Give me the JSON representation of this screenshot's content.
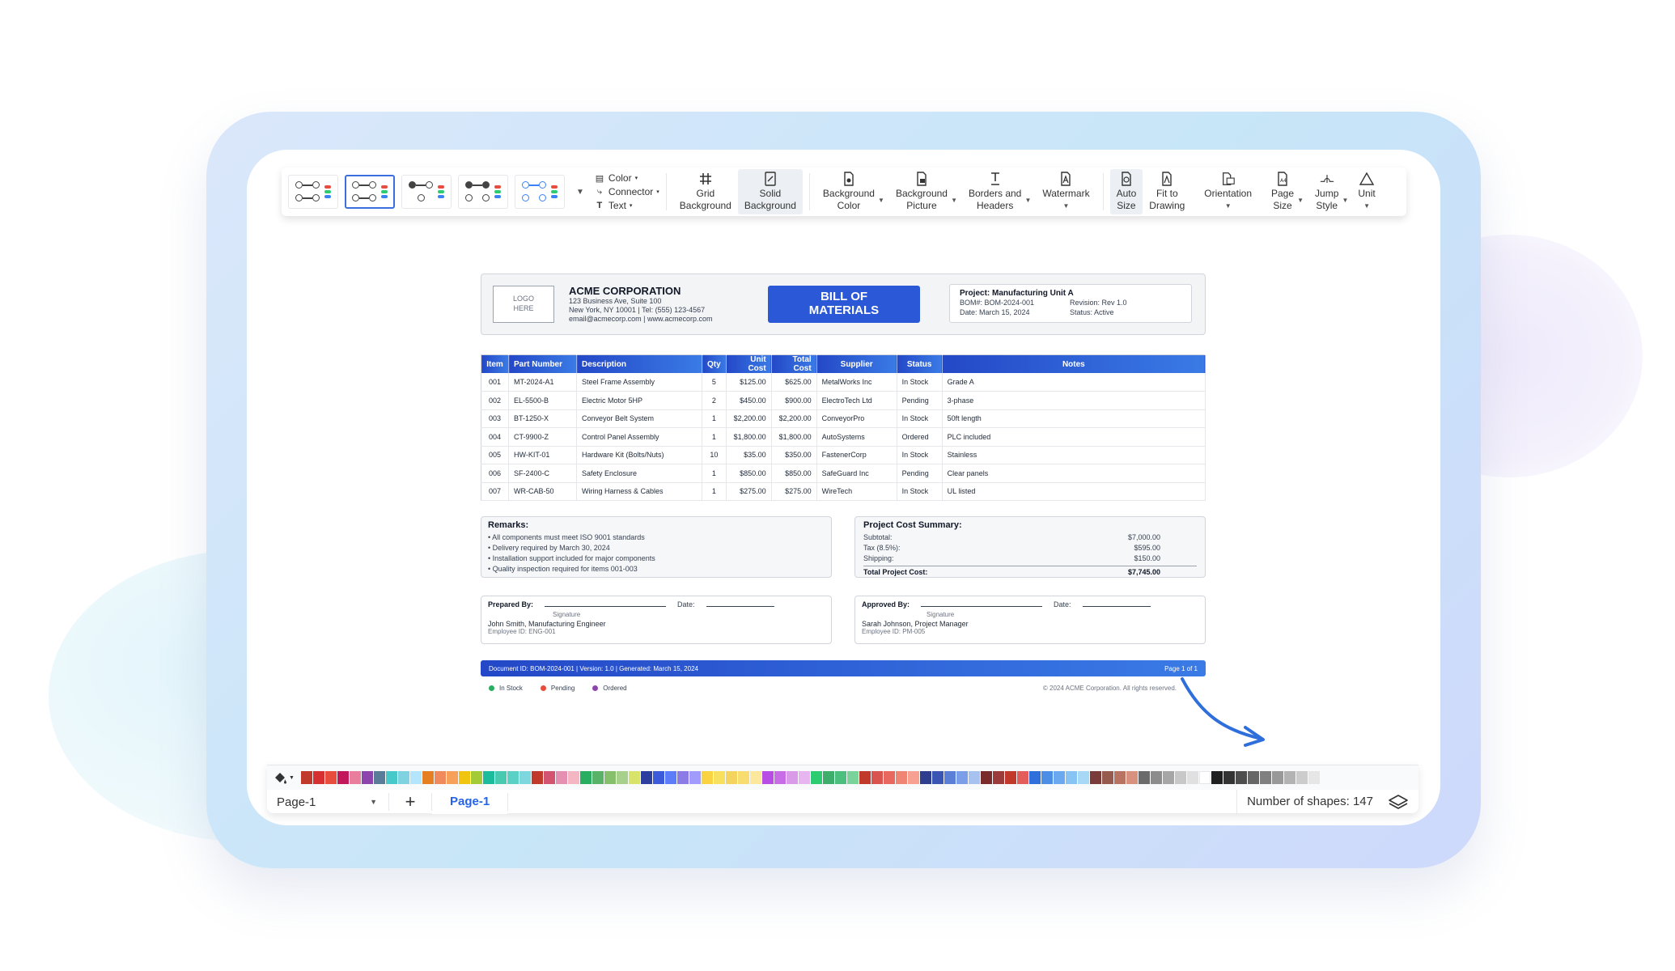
{
  "toolbar": {
    "style_items": [
      {
        "icon": "color-icon",
        "label": "Color"
      },
      {
        "icon": "connector-icon",
        "label": "Connector"
      },
      {
        "icon": "text-icon",
        "label": "Text"
      }
    ],
    "buttons": [
      {
        "name": "grid-background",
        "line1": "Grid",
        "line2": "Background"
      },
      {
        "name": "solid-background",
        "line1": "Solid",
        "line2": "Background"
      },
      {
        "name": "background-color",
        "line1": "Background",
        "line2": "Color"
      },
      {
        "name": "background-picture",
        "line1": "Background",
        "line2": "Picture"
      },
      {
        "name": "borders-and-headers",
        "line1": "Borders and",
        "line2": "Headers"
      },
      {
        "name": "watermark",
        "line1": "Watermark",
        "line2": ""
      },
      {
        "name": "auto-size",
        "line1": "Auto",
        "line2": "Size"
      },
      {
        "name": "fit-to-drawing",
        "line1": "Fit to",
        "line2": "Drawing"
      },
      {
        "name": "orientation",
        "line1": "Orientation",
        "line2": ""
      },
      {
        "name": "page-size",
        "line1": "Page",
        "line2": "Size"
      },
      {
        "name": "jump-style",
        "line1": "Jump",
        "line2": "Style"
      },
      {
        "name": "unit",
        "line1": "Unit",
        "line2": ""
      }
    ]
  },
  "doc": {
    "logo": "LOGO\nHERE",
    "company_name": "ACME CORPORATION",
    "company_address": "123 Business Ave, Suite 100",
    "company_city": "New York, NY 10001 | Tel: (555) 123-4567",
    "company_email": "email@acmecorp.com | www.acmecorp.com",
    "title_line1": "BILL OF",
    "title_line2": "MATERIALS",
    "project": "Project: Manufacturing Unit A",
    "bom_no": "BOM#: BOM-2024-001",
    "revision": "Revision: Rev 1.0",
    "date": "Date: March 15, 2024",
    "status": "Status: Active",
    "columns": [
      "Item",
      "Part Number",
      "Description",
      "Qty",
      "Unit Cost",
      "Total Cost",
      "Supplier",
      "Status",
      "Notes"
    ],
    "rows": [
      [
        "001",
        "MT-2024-A1",
        "Steel Frame Assembly",
        "5",
        "$125.00",
        "$625.00",
        "MetalWorks Inc",
        "In Stock",
        "Grade A"
      ],
      [
        "002",
        "EL-5500-B",
        "Electric Motor 5HP",
        "2",
        "$450.00",
        "$900.00",
        "ElectroTech Ltd",
        "Pending",
        "3-phase"
      ],
      [
        "003",
        "BT-1250-X",
        "Conveyor Belt System",
        "1",
        "$2,200.00",
        "$2,200.00",
        "ConveyorPro",
        "In Stock",
        "50ft length"
      ],
      [
        "004",
        "CT-9900-Z",
        "Control Panel Assembly",
        "1",
        "$1,800.00",
        "$1,800.00",
        "AutoSystems",
        "Ordered",
        "PLC included"
      ],
      [
        "005",
        "HW-KIT-01",
        "Hardware Kit (Bolts/Nuts)",
        "10",
        "$35.00",
        "$350.00",
        "FastenerCorp",
        "In Stock",
        "Stainless"
      ],
      [
        "006",
        "SF-2400-C",
        "Safety Enclosure",
        "1",
        "$850.00",
        "$850.00",
        "SafeGuard Inc",
        "Pending",
        "Clear panels"
      ],
      [
        "007",
        "WR-CAB-50",
        "Wiring Harness & Cables",
        "1",
        "$275.00",
        "$275.00",
        "WireTech",
        "In Stock",
        "UL listed"
      ]
    ],
    "remarks_title": "Remarks:",
    "remarks": [
      "• All components must meet ISO 9001 standards",
      "• Delivery required by March 30, 2024",
      "• Installation support included for major components",
      "• Quality inspection required for items 001-003"
    ],
    "summary_title": "Project Cost Summary:",
    "summary": [
      {
        "label": "Subtotal:",
        "value": "$7,000.00"
      },
      {
        "label": "Tax (8.5%):",
        "value": "$595.00"
      },
      {
        "label": "Shipping:",
        "value": "$150.00"
      }
    ],
    "total_label": "Total Project Cost:",
    "total_value": "$7,745.00",
    "prepared_label": "Prepared By:",
    "approved_label": "Approved By:",
    "date_label": "Date:",
    "signature_label": "Signature",
    "prepared_name": "John Smith, Manufacturing Engineer",
    "prepared_emp": "Employee ID: ENG-001",
    "approved_name": "Sarah Johnson, Project Manager",
    "approved_emp": "Employee ID: PM-005",
    "footer_left": "Document ID: BOM-2024-001 | Version: 1.0 | Generated: March 15, 2024",
    "footer_right": "Page 1 of 1",
    "legend": [
      {
        "label": "In Stock",
        "color": "#27ae60"
      },
      {
        "label": "Pending",
        "color": "#e74c3c"
      },
      {
        "label": "Ordered",
        "color": "#8e44ad"
      }
    ],
    "copyright": "© 2024 ACME Corporation. All rights reserved."
  },
  "palette": [
    "#c0392b",
    "#d63031",
    "#e74c3c",
    "#c2185b",
    "#e87d9e",
    "#8e44ad",
    "#5b7c99",
    "#48c9c9",
    "#7fd3e0",
    "#b3e5fc",
    "#e67e22",
    "#f08a5d",
    "#f6a05a",
    "#f1c40f",
    "#a3cb38",
    "#1abc9c",
    "#48c9b0",
    "#5ad1c5",
    "#7ed6df",
    "#c0392b",
    "#d35470",
    "#e58fb2",
    "#f4b6c2",
    "#27ae60",
    "#58b368",
    "#86c06c",
    "#a8d08d",
    "#d8e36a",
    "#2c3e9e",
    "#3b5bdb",
    "#5c7cfa",
    "#8c7ae6",
    "#a29bfe",
    "#f9d342",
    "#f6e05e",
    "#f4d35e",
    "#f7dc6f",
    "#fbe89c",
    "#b84de6",
    "#c86ce8",
    "#d99be8",
    "#e7b6f0",
    "#2ecc71",
    "#3fae6b",
    "#4cbf7f",
    "#7ad39a",
    "#c0392b",
    "#d9534f",
    "#e8675f",
    "#f08573",
    "#f6a192",
    "#2d3e8f",
    "#3a55b4",
    "#5b7ed6",
    "#7c9ee8",
    "#a8c2f0",
    "#7a2a2a",
    "#9b3b3b",
    "#c0392b",
    "#e35d5b",
    "#2f6fdb",
    "#4c8de6",
    "#6aa8ef",
    "#87c3f3",
    "#a7d8f5",
    "#7a3b3b",
    "#965a4e",
    "#b87363",
    "#d9917f",
    "#6b6b6b",
    "#8c8c8c",
    "#a6a6a6",
    "#c8c8c8",
    "#e0e0e0",
    "#ffffff",
    "#1f1f1f",
    "#333333",
    "#4d4d4d",
    "#666666",
    "#808080",
    "#999999",
    "#b3b3b3",
    "#cccccc",
    "#e6e6e6"
  ],
  "tabs": {
    "page_select": "Page-1",
    "active_tab": "Page-1",
    "shape_count": "Number of shapes: 147"
  }
}
